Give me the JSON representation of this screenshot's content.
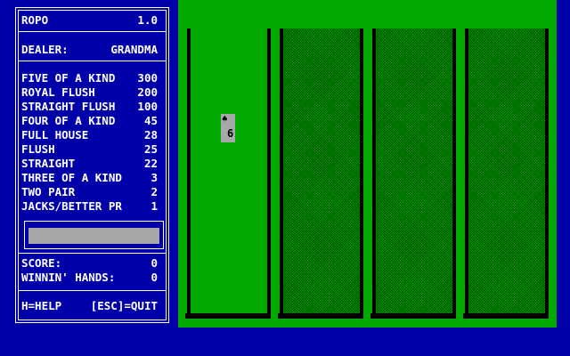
{
  "title": "ROPO",
  "version": "1.0",
  "dealer_label": "DEALER:",
  "dealer_name": "GRANDMA",
  "payouts": [
    {
      "hand": "FIVE OF A KIND",
      "value": "300"
    },
    {
      "hand": "ROYAL FLUSH",
      "value": "200"
    },
    {
      "hand": "STRAIGHT FLUSH",
      "value": "100"
    },
    {
      "hand": "FOUR OF A KIND",
      "value": "45"
    },
    {
      "hand": "FULL HOUSE",
      "value": "28"
    },
    {
      "hand": "FLUSH",
      "value": "25"
    },
    {
      "hand": "STRAIGHT",
      "value": "22"
    },
    {
      "hand": "THREE OF A KIND",
      "value": "3"
    },
    {
      "hand": "TWO PAIR",
      "value": "2"
    },
    {
      "hand": "JACKS/BETTER PR",
      "value": "1"
    }
  ],
  "score_label": "SCORE:",
  "score_value": "0",
  "winning_label": "WINNIN' HANDS:",
  "winning_value": "0",
  "help_text": "H=HELP",
  "quit_text": "[ESC]=QUIT",
  "card": {
    "suit": "♠",
    "suit_icon": "spade-icon",
    "rank": "6"
  },
  "colors": {
    "background": "#0000a8",
    "table": "#00a800",
    "card": "#a8a8a8",
    "panel_text": "#ffffff"
  }
}
